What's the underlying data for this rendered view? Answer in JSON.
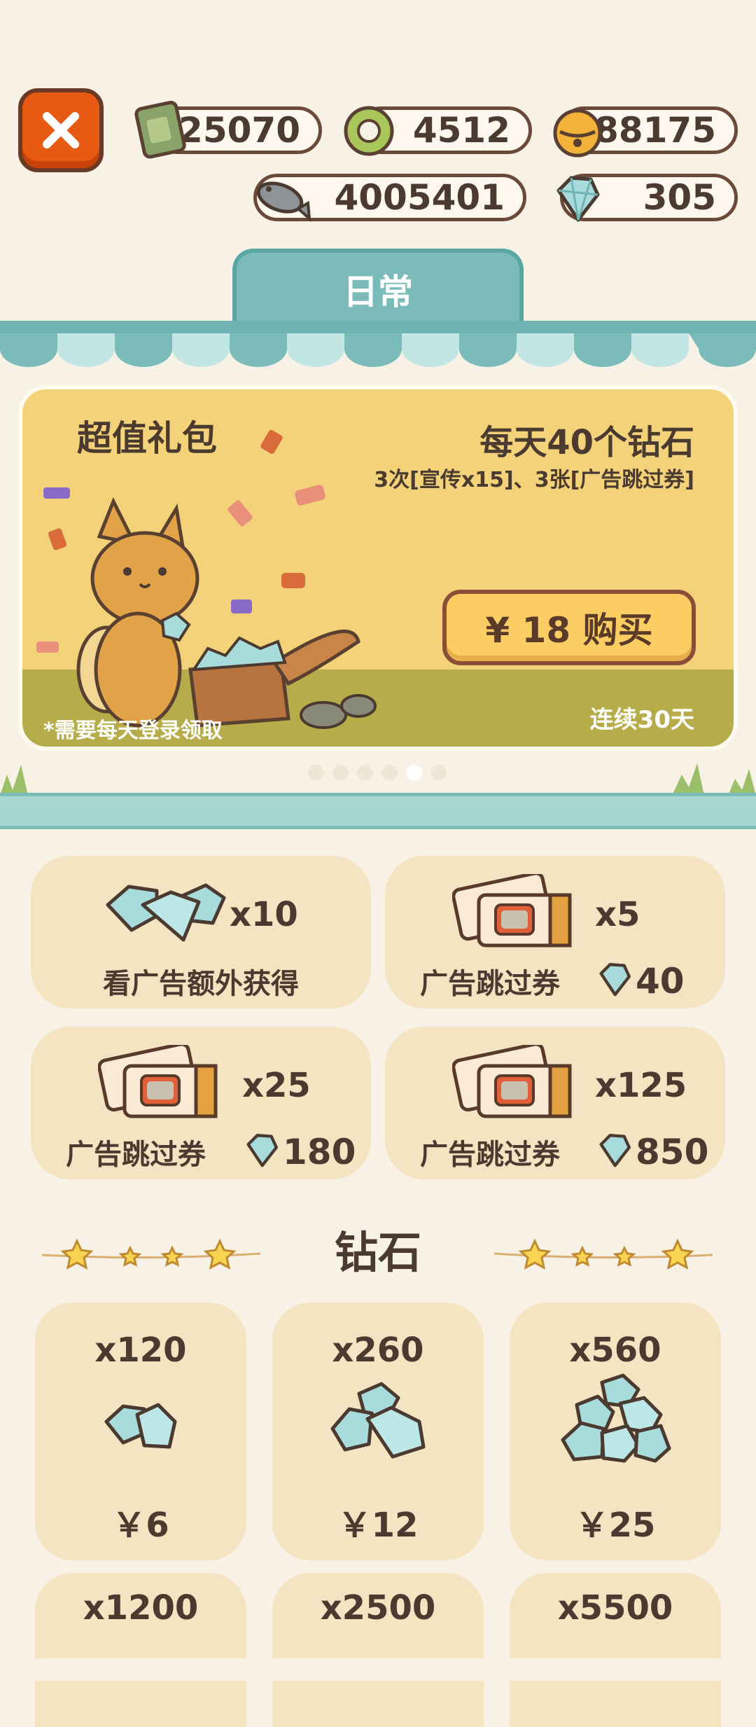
{
  "currencies": {
    "cash": "25070",
    "ring": "4512",
    "bell": "88175",
    "fish": "4005401",
    "gem": "305"
  },
  "tab": {
    "label": "日常"
  },
  "banner": {
    "title": "超值礼包",
    "headline": "每天40个钻石",
    "detail": "3次[宣传x15]、3张[广告跳过券]",
    "buy_label": "¥ 18 购买",
    "note": "*需要每天登录领取",
    "duration": "连续30天",
    "page_count": 6,
    "active_page": 5
  },
  "offers": [
    {
      "qty": "x10",
      "label": "看广告额外获得",
      "price": ""
    },
    {
      "qty": "x5",
      "label": "广告跳过券",
      "price": "40"
    },
    {
      "qty": "x25",
      "label": "广告跳过券",
      "price": "180"
    },
    {
      "qty": "x125",
      "label": "广告跳过券",
      "price": "850"
    }
  ],
  "diamond_section": {
    "title": "钻石"
  },
  "diamonds": [
    {
      "qty": "x120",
      "price": "￥6"
    },
    {
      "qty": "x260",
      "price": "￥12"
    },
    {
      "qty": "x560",
      "price": "￥25"
    },
    {
      "qty": "x1200",
      "price": ""
    },
    {
      "qty": "x2500",
      "price": ""
    },
    {
      "qty": "x5500",
      "price": ""
    }
  ],
  "colors": {
    "accent_teal": "#7bbcba",
    "close_orange": "#e85a12",
    "banner_yellow": "#f4d27a"
  }
}
